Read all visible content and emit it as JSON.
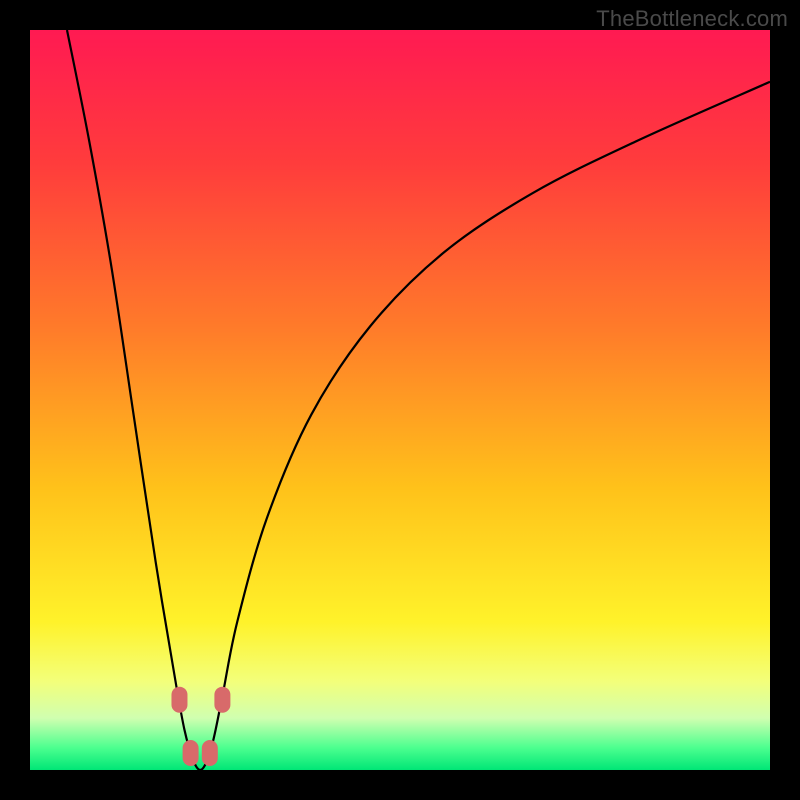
{
  "watermark": "TheBottleneck.com",
  "colors": {
    "frame": "#000000",
    "curve": "#000000",
    "marker": "#d86a6a",
    "gradient_stops": [
      {
        "offset": 0.0,
        "color": "#ff1a52"
      },
      {
        "offset": 0.18,
        "color": "#ff3c3c"
      },
      {
        "offset": 0.4,
        "color": "#ff7a2a"
      },
      {
        "offset": 0.62,
        "color": "#ffc21a"
      },
      {
        "offset": 0.8,
        "color": "#fff22a"
      },
      {
        "offset": 0.88,
        "color": "#f3ff7a"
      },
      {
        "offset": 0.93,
        "color": "#d0ffb0"
      },
      {
        "offset": 0.97,
        "color": "#4cff8f"
      },
      {
        "offset": 1.0,
        "color": "#00e676"
      }
    ]
  },
  "chart_data": {
    "type": "line",
    "title": "",
    "xlabel": "",
    "ylabel": "",
    "xlim": [
      0,
      100
    ],
    "ylim": [
      0,
      100
    ],
    "note": "Values read visually as percent-of-plot (0,0 bottom-left to 100,100 top-right). Curve is a V-shaped bottleneck profile with minimum near x≈23; left branch is steep, right branch rises toward upper-right corner.",
    "series": [
      {
        "name": "bottleneck-curve",
        "x": [
          5,
          8,
          11,
          14,
          17,
          20,
          21.5,
          23,
          24.5,
          26,
          28,
          32,
          38,
          46,
          56,
          68,
          82,
          100
        ],
        "y": [
          100,
          85,
          68,
          48,
          28,
          10,
          3,
          0,
          3,
          10,
          20,
          34,
          48,
          60,
          70,
          78,
          85,
          93
        ]
      }
    ],
    "markers": [
      {
        "name": "left-upper",
        "x": 20.2,
        "y": 9.5
      },
      {
        "name": "left-lower",
        "x": 21.7,
        "y": 2.3
      },
      {
        "name": "right-lower",
        "x": 24.3,
        "y": 2.3
      },
      {
        "name": "right-upper",
        "x": 26.0,
        "y": 9.5
      }
    ]
  }
}
